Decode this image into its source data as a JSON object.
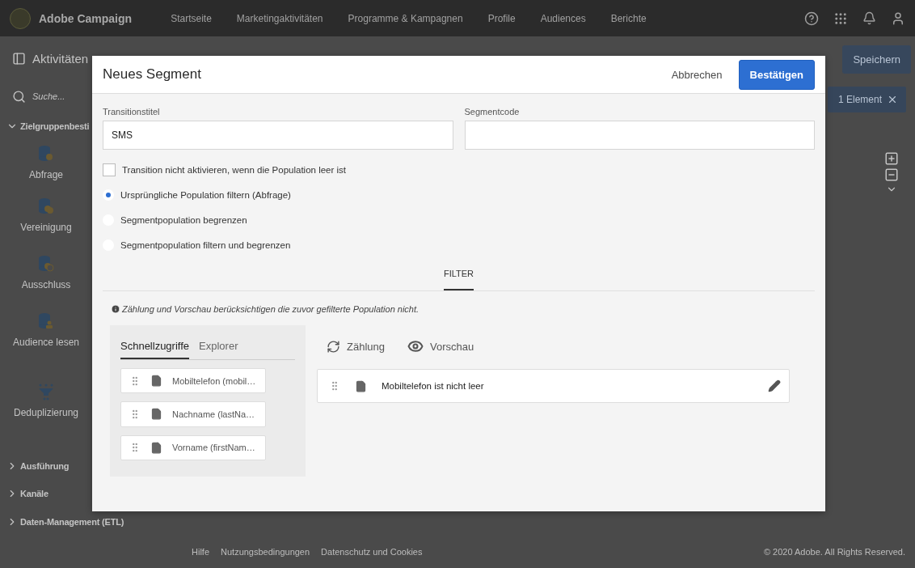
{
  "header": {
    "brand": "Adobe Campaign",
    "nav": [
      {
        "label": "Startseite"
      },
      {
        "label": "Marketingaktivitäten"
      },
      {
        "label": "Programme & Kampagnen"
      },
      {
        "label": "Profile"
      },
      {
        "label": "Audiences"
      },
      {
        "label": "Berichte"
      }
    ]
  },
  "sidebar": {
    "title": "Aktivitäten",
    "search_placeholder": "Suche...",
    "sections": [
      {
        "label": "Zielgruppenbesti",
        "expanded": true,
        "items": [
          {
            "label": "Abfrage",
            "kind": "query"
          },
          {
            "label": "Vereinigung",
            "kind": "union"
          },
          {
            "label": "Ausschluss",
            "kind": "exclusion"
          },
          {
            "label": "Audience lesen",
            "kind": "audience"
          },
          {
            "label": "Deduplizierung",
            "kind": "dedup"
          }
        ]
      },
      {
        "label": "Ausführung",
        "expanded": false
      },
      {
        "label": "Kanäle",
        "expanded": false
      },
      {
        "label": "Daten-Management (ETL)",
        "expanded": false
      }
    ]
  },
  "toolbar": {
    "save_button": "Speichern",
    "selection_badge": "1 Element"
  },
  "footer": {
    "links": [
      "Hilfe",
      "Nutzungsbedingungen",
      "Datenschutz und Cookies"
    ],
    "copyright": "© 2020 Adobe. All Rights Reserved."
  },
  "dialog": {
    "title": "Neues Segment",
    "cancel": "Abbrechen",
    "confirm": "Bestätigen",
    "fields": [
      {
        "label": "Transitionstitel",
        "value": "SMS"
      },
      {
        "label": "Segmentcode"
      }
    ],
    "checkbox": {
      "label": "Transition nicht aktivieren, wenn die Population leer ist",
      "checked": false
    },
    "radios": [
      {
        "label": "Ursprüngliche Population filtern (Abfrage)",
        "selected": true
      },
      {
        "label": "Segmentpopulation begrenzen",
        "selected": false
      },
      {
        "label": "Segmentpopulation filtern und begrenzen",
        "selected": false
      }
    ],
    "tabs": [
      {
        "label": "FILTER",
        "selected": true
      }
    ],
    "note": "Zählung und Vorschau berücksichtigen die zuvor gefilterte Population nicht.",
    "palette": {
      "tabs": [
        {
          "label": "Schnellzugriffe",
          "selected": true
        },
        {
          "label": "Explorer",
          "selected": false
        }
      ],
      "items": [
        {
          "label": "Mobiltelefon (mobil…"
        },
        {
          "label": "Nachname (lastNa…"
        },
        {
          "label": "Vorname (firstNam…"
        }
      ]
    },
    "actions": [
      {
        "label": "Zählung",
        "kind": "count"
      },
      {
        "label": "Vorschau",
        "kind": "preview"
      }
    ],
    "rules": [
      {
        "label": "Mobiltelefon ist nicht leer"
      }
    ]
  }
}
